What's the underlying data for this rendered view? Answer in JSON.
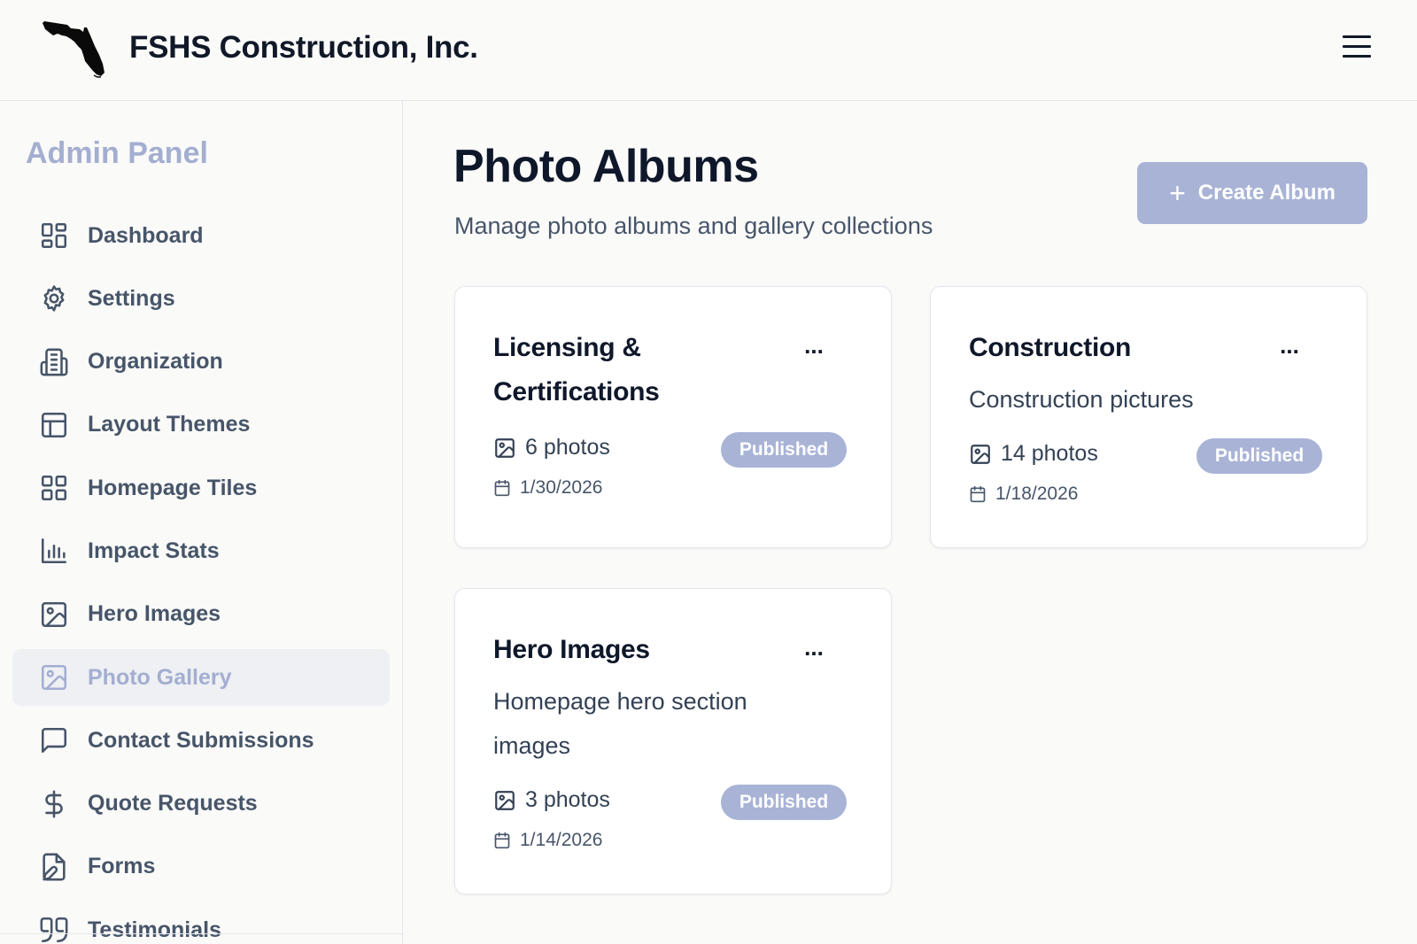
{
  "header": {
    "brand": "FSHS Construction, Inc.",
    "logo_icon": "florida-state-icon",
    "menu_icon": "hamburger-menu-icon"
  },
  "sidebar": {
    "title": "Admin Panel",
    "items": [
      {
        "label": "Dashboard",
        "icon": "dashboard-grid-icon"
      },
      {
        "label": "Settings",
        "icon": "gear-icon"
      },
      {
        "label": "Organization",
        "icon": "building-icon"
      },
      {
        "label": "Layout Themes",
        "icon": "layout-icon"
      },
      {
        "label": "Homepage Tiles",
        "icon": "tiles-grid-icon"
      },
      {
        "label": "Impact Stats",
        "icon": "bar-chart-icon"
      },
      {
        "label": "Hero Images",
        "icon": "image-icon"
      },
      {
        "label": "Photo Gallery",
        "icon": "image-icon",
        "active": true
      },
      {
        "label": "Contact Submissions",
        "icon": "message-icon"
      },
      {
        "label": "Quote Requests",
        "icon": "dollar-icon"
      },
      {
        "label": "Forms",
        "icon": "file-edit-icon"
      },
      {
        "label": "Testimonials",
        "icon": "quote-icon"
      }
    ]
  },
  "main": {
    "title": "Photo Albums",
    "subtitle": "Manage photo albums and gallery collections",
    "create_button": "Create Album",
    "more_label": "...",
    "albums": [
      {
        "title": "Licensing & Certifications",
        "description": "",
        "photos": "6 photos",
        "status": "Published",
        "date": "1/30/2026"
      },
      {
        "title": "Construction",
        "description": "Construction pictures",
        "photos": "14 photos",
        "status": "Published",
        "date": "1/18/2026"
      },
      {
        "title": "Hero Images",
        "description": "Homepage hero section images",
        "photos": "3 photos",
        "status": "Published",
        "date": "1/14/2026"
      }
    ]
  },
  "colors": {
    "accent": "#a8b3d6",
    "active_bg": "#eef0f4",
    "text": "#0f172a",
    "muted": "#475569"
  }
}
